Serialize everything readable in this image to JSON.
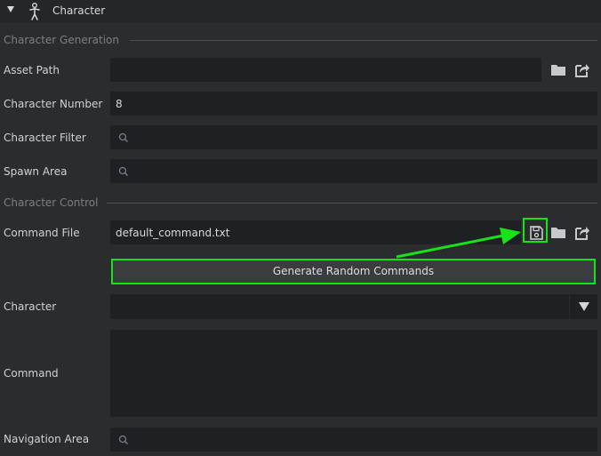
{
  "header": {
    "title": "Character",
    "expand_icon": "caret-down-icon",
    "person_icon": "person-icon"
  },
  "sections": {
    "generation": "Character Generation",
    "control": "Character Control"
  },
  "fields": {
    "asset_path": {
      "label": "Asset Path",
      "value": ""
    },
    "character_number": {
      "label": "Character Number",
      "value": "8"
    },
    "character_filter": {
      "label": "Character Filter",
      "value": ""
    },
    "spawn_area": {
      "label": "Spawn Area",
      "value": ""
    },
    "command_file": {
      "label": "Command File",
      "value": "default_command.txt"
    },
    "character": {
      "label": "Character",
      "value": ""
    },
    "command": {
      "label": "Command",
      "value": ""
    },
    "navigation_area": {
      "label": "Navigation Area",
      "value": ""
    }
  },
  "buttons": {
    "generate": "Generate Random Commands"
  },
  "colors": {
    "highlight": "#18e218",
    "background": "#2b2c2e",
    "field": "#1f2023"
  }
}
